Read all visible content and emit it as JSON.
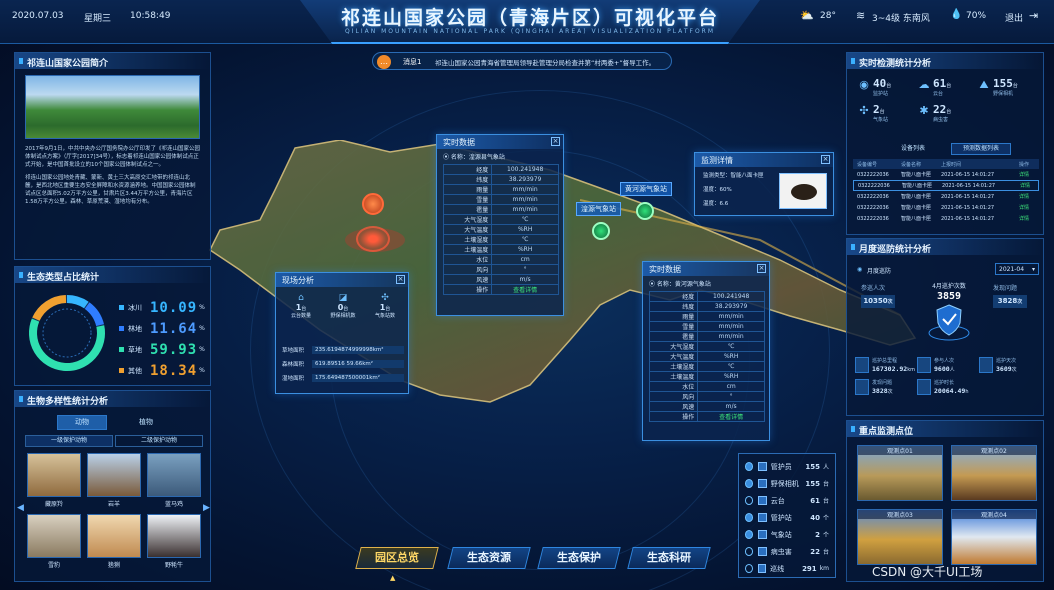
{
  "header": {
    "date": "2020.07.03",
    "weekday": "星期三",
    "time": "10:58:49",
    "title": "祁连山国家公园（青海片区）可视化平台",
    "subtitle": "QILIAN MOUNTAIN NATIONAL PARK (QINGHAI AREA) VISUALIZATION PLATFORM",
    "temperature": "28°",
    "wind": "3~4级 东南风",
    "humidity": "70%",
    "logout": "退出"
  },
  "notice": {
    "label": "消息1",
    "text": "祁连山国家公园青海省管理局领导赴管理分局检查并第“村两委+”督导工作。"
  },
  "intro": {
    "title": "祁连山国家公园简介",
    "p1": "2017年9月1日，中共中央办公厅国务院办公厅印发了《祁连山国家公园体制试点方案》（厅字[2017]34号），标志着祁连山国家公园体制试点正式开始，是中国首批设立的10个国家公园体制试点之一。",
    "p2": "祁连山国家公园地处青藏、蒙新、黄土三大高原交汇地带的祁连山北麓，是西北地区重要生态安全屏障和水资源涵养地。中国国家公园体制试点区总面积5.02万平方公里，甘肃片区3.44万平方公里，青海片区1.58万平方公里。森林、草原荒漠、湿地均有分布。"
  },
  "eco": {
    "title": "生态类型占比统计",
    "items": [
      {
        "name": "冰川",
        "value": "10.09",
        "unit": "%",
        "color": "#36b6ff"
      },
      {
        "name": "林地",
        "value": "11.64",
        "unit": "%",
        "color": "#2f7dff"
      },
      {
        "name": "草地",
        "value": "59.93",
        "unit": "%",
        "color": "#2fe0b0"
      },
      {
        "name": "其他",
        "value": "18.34",
        "unit": "%",
        "color": "#f0a030"
      }
    ]
  },
  "bio": {
    "title": "生物多样性统计分析",
    "tabs": [
      "动物",
      "植物"
    ],
    "subtabs": [
      "一级保护动物",
      "二级保护动物"
    ],
    "animals": [
      "藏原羚",
      "岩羊",
      "蓝马鸡",
      "雪豹",
      "猞猁",
      "野牦牛"
    ]
  },
  "realtime": {
    "title": "实时检测统计分析",
    "stats": [
      {
        "icon": "camera-icon",
        "value": "40",
        "unit": "台",
        "label": "监护站"
      },
      {
        "icon": "cloud-icon",
        "value": "61",
        "unit": "台",
        "label": "云台"
      },
      {
        "icon": "tower-icon",
        "value": "155",
        "unit": "台",
        "label": "野保相机"
      },
      {
        "icon": "windmill-icon",
        "value": "2",
        "unit": "台",
        "label": "气象站"
      },
      {
        "icon": "bug-icon",
        "value": "22",
        "unit": "台",
        "label": "病虫害"
      }
    ],
    "tabs": [
      "设备列表",
      "预测数据列表"
    ],
    "headers": [
      "设备编号",
      "设备名称",
      "上报时间",
      "操作"
    ],
    "rows": [
      {
        "id": "0322222036",
        "name": "智能八面卡匣",
        "time": "2021-06-15 14:01:27",
        "op": "详情"
      },
      {
        "id": "0322222036",
        "name": "智能八面卡匣",
        "time": "2021-06-15 14:01:27",
        "op": "详情"
      },
      {
        "id": "0322222036",
        "name": "智能八面卡匣",
        "time": "2021-06-15 14:01:27",
        "op": "详情"
      },
      {
        "id": "0322222036",
        "name": "智能八面卡匣",
        "time": "2021-06-15 14:01:27",
        "op": "详情"
      },
      {
        "id": "0322222036",
        "name": "智能八面卡匣",
        "time": "2021-06-15 14:01:27",
        "op": "详情"
      }
    ]
  },
  "patrol": {
    "title": "月度巡防统计分析",
    "period_label": "月度巡防",
    "month": "2021-04",
    "participants_label": "参巡人次",
    "participants": "10350",
    "participants_unit": "次",
    "center_label": "4月巡护次数",
    "center_value": "3859",
    "found_label": "发现问题",
    "found": "3828",
    "found_unit": "次",
    "stats": [
      {
        "label": "巡护总里程",
        "value": "167302.92",
        "unit": "km"
      },
      {
        "label": "参与人次",
        "value": "9600",
        "unit": "人"
      },
      {
        "label": "巡护天次",
        "value": "3609",
        "unit": "次"
      },
      {
        "label": "发现问题",
        "value": "3828",
        "unit": "次"
      },
      {
        "label": "巡护时长",
        "value": "20064.49",
        "unit": "h"
      }
    ]
  },
  "monitor": {
    "title": "重点监测点位",
    "items": [
      "观测点01",
      "观测点02",
      "观测点03",
      "观测点04"
    ]
  },
  "map": {
    "pins": [
      "湟源气象站",
      "黄河源气象站"
    ]
  },
  "win1": {
    "title": "实时数据",
    "place": "名称：湟源县气象站",
    "rows": [
      {
        "k": "经度",
        "v": "100.241948"
      },
      {
        "k": "纬度",
        "v": "38.293979"
      },
      {
        "k": "雨量",
        "v": "mm/min"
      },
      {
        "k": "雪量",
        "v": "mm/min"
      },
      {
        "k": "雹量",
        "v": "mm/min"
      },
      {
        "k": "大气湿度",
        "v": "℃"
      },
      {
        "k": "大气温度",
        "v": "%RH"
      },
      {
        "k": "土壤湿度",
        "v": "℃"
      },
      {
        "k": "土壤温度",
        "v": "%RH"
      },
      {
        "k": "水位",
        "v": "cm"
      },
      {
        "k": "风向",
        "v": "°"
      },
      {
        "k": "风速",
        "v": "m/s"
      },
      {
        "k": "操作",
        "v": "查看详情"
      }
    ]
  },
  "win2": {
    "title": "监测详情",
    "type": "监测类型：智能八面卡匣",
    "temp_label": "湿度：",
    "temp": "60%",
    "humid_label": "温度：",
    "humid": "6.6"
  },
  "win3": {
    "title": "现场分析",
    "counts": [
      {
        "value": "1",
        "unit": "台",
        "label": "云台数量"
      },
      {
        "value": "0",
        "unit": "台",
        "label": "野保相机数"
      },
      {
        "value": "1",
        "unit": "台",
        "label": "气象站数"
      }
    ],
    "areas": [
      {
        "k": "草地面积",
        "v": "235.6194874999998km²"
      },
      {
        "k": "森林面积",
        "v": "619.89516 59.66km²"
      },
      {
        "k": "湿地面积",
        "v": "175.649487500001km²"
      }
    ]
  },
  "win4": {
    "title": "实时数据",
    "place": "名称：黄河源气象站",
    "rows": [
      {
        "k": "经度",
        "v": "100.241948"
      },
      {
        "k": "纬度",
        "v": "38.293979"
      },
      {
        "k": "雨量",
        "v": "mm/min"
      },
      {
        "k": "雪量",
        "v": "mm/min"
      },
      {
        "k": "雹量",
        "v": "mm/min"
      },
      {
        "k": "大气湿度",
        "v": "℃"
      },
      {
        "k": "大气温度",
        "v": "%RH"
      },
      {
        "k": "土壤湿度",
        "v": "℃"
      },
      {
        "k": "土壤温度",
        "v": "%RH"
      },
      {
        "k": "水位",
        "v": "cm"
      },
      {
        "k": "风向",
        "v": "°"
      },
      {
        "k": "风速",
        "v": "m/s"
      },
      {
        "k": "操作",
        "v": "查看详情"
      }
    ]
  },
  "legend": [
    {
      "label": "管护员",
      "value": "155",
      "unit": "人",
      "checked": true
    },
    {
      "label": "野保相机",
      "value": "155",
      "unit": "台",
      "checked": true
    },
    {
      "label": "云台",
      "value": "61",
      "unit": "台",
      "checked": false
    },
    {
      "label": "管护站",
      "value": "40",
      "unit": "个",
      "checked": true
    },
    {
      "label": "气象站",
      "value": "2",
      "unit": "个",
      "checked": true
    },
    {
      "label": "病虫害",
      "value": "22",
      "unit": "台",
      "checked": false
    },
    {
      "label": "巡线",
      "value": "291",
      "unit": "km",
      "checked": false
    }
  ],
  "nav": [
    "园区总览",
    "生态资源",
    "生态保护",
    "生态科研"
  ],
  "watermark": "CSDN @大千UI工场"
}
